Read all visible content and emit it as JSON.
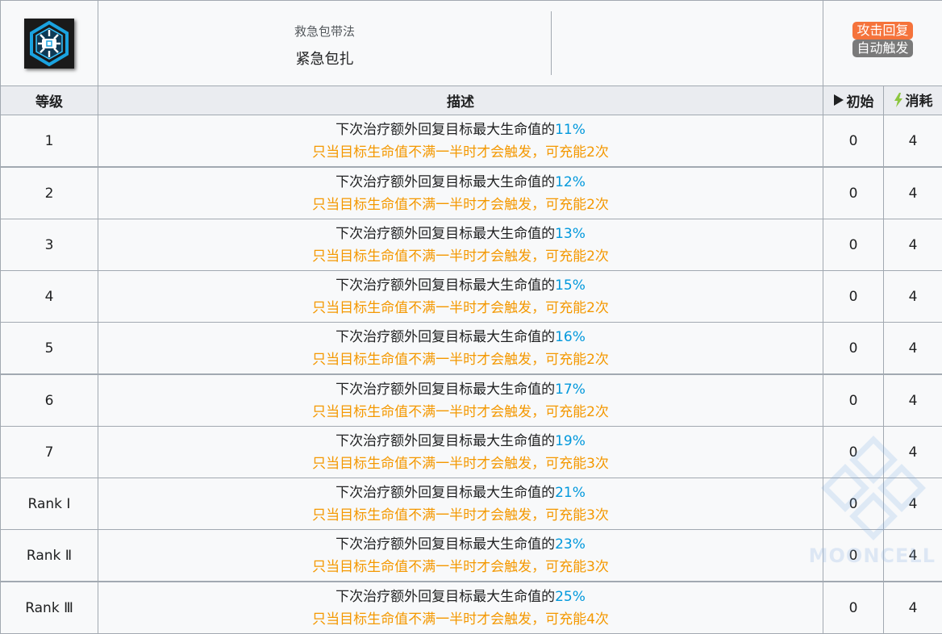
{
  "skill": {
    "icon": "medical-kit-icon",
    "category": "救急包带法",
    "name": "紧急包扎",
    "tags": [
      {
        "label": "攻击回复",
        "color": "#f5733b"
      },
      {
        "label": "自动触发",
        "color": "#7a7a7a"
      }
    ]
  },
  "columns": {
    "level": "等级",
    "description": "描述",
    "initial": "初始",
    "initial_icon": "play-icon",
    "cost": "消耗",
    "cost_icon": "lightning-icon"
  },
  "rows": [
    {
      "level": "1",
      "desc_prefix": "下次治疗额外回复目标最大生命值的",
      "pct": "11%",
      "note": "只当目标生命值不满一半时才会触发，可充能2次",
      "initial": "0",
      "cost": "4"
    },
    {
      "level": "2",
      "desc_prefix": "下次治疗额外回复目标最大生命值的",
      "pct": "12%",
      "note": "只当目标生命值不满一半时才会触发，可充能2次",
      "initial": "0",
      "cost": "4"
    },
    {
      "level": "3",
      "desc_prefix": "下次治疗额外回复目标最大生命值的",
      "pct": "13%",
      "note": "只当目标生命值不满一半时才会触发，可充能2次",
      "initial": "0",
      "cost": "4"
    },
    {
      "level": "4",
      "desc_prefix": "下次治疗额外回复目标最大生命值的",
      "pct": "15%",
      "note": "只当目标生命值不满一半时才会触发，可充能2次",
      "initial": "0",
      "cost": "4"
    },
    {
      "level": "5",
      "desc_prefix": "下次治疗额外回复目标最大生命值的",
      "pct": "16%",
      "note": "只当目标生命值不满一半时才会触发，可充能2次",
      "initial": "0",
      "cost": "4"
    },
    {
      "level": "6",
      "desc_prefix": "下次治疗额外回复目标最大生命值的",
      "pct": "17%",
      "note": "只当目标生命值不满一半时才会触发，可充能2次",
      "initial": "0",
      "cost": "4"
    },
    {
      "level": "7",
      "desc_prefix": "下次治疗额外回复目标最大生命值的",
      "pct": "19%",
      "note": "只当目标生命值不满一半时才会触发，可充能3次",
      "initial": "0",
      "cost": "4"
    },
    {
      "level": "Rank Ⅰ",
      "desc_prefix": "下次治疗额外回复目标最大生命值的",
      "pct": "21%",
      "note": "只当目标生命值不满一半时才会触发，可充能3次",
      "initial": "0",
      "cost": "4"
    },
    {
      "level": "Rank Ⅱ",
      "desc_prefix": "下次治疗额外回复目标最大生命值的",
      "pct": "23%",
      "note": "只当目标生命值不满一半时才会触发，可充能3次",
      "initial": "0",
      "cost": "4"
    },
    {
      "level": "Rank Ⅲ",
      "desc_prefix": "下次治疗额外回复目标最大生命值的",
      "pct": "25%",
      "note": "只当目标生命值不满一半时才会触发，可充能4次",
      "initial": "0",
      "cost": "4"
    }
  ],
  "watermark": {
    "text": "MOONCELL"
  }
}
